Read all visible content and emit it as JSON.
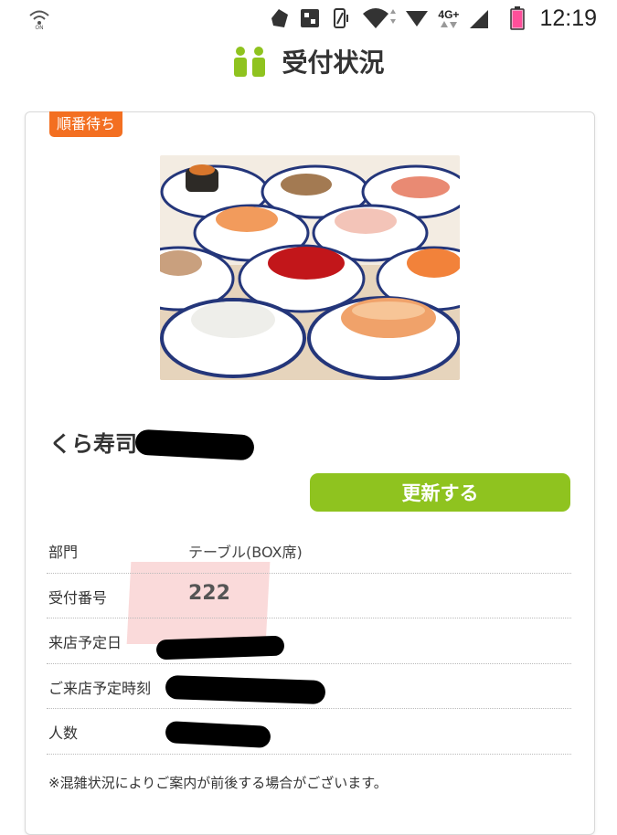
{
  "status_bar": {
    "time": "12:19",
    "network_label": "4G+",
    "icons": [
      "vowifi-icon",
      "notification-icon",
      "nfc-icon",
      "vibrate-icon",
      "wifi-icon",
      "signal-icon",
      "battery-icon"
    ]
  },
  "header": {
    "title": "受付状況",
    "icon": "people-icon",
    "accent_color": "#8fc31f"
  },
  "card": {
    "badge": "順番待ち",
    "badge_color": "#f36f21",
    "photo_alt": "sushi-photo",
    "store_name": "くら寿司",
    "refresh_button": "更新する",
    "rows": [
      {
        "label": "部門",
        "value": "テーブル(BOX席)"
      },
      {
        "label": "受付番号",
        "value": "222"
      },
      {
        "label": "来店予定日",
        "value": ""
      },
      {
        "label": "ご来店予定時刻",
        "value": ""
      },
      {
        "label": "人数",
        "value": ""
      }
    ],
    "note": "※混雑状況によりご案内が前後する場合がございます。"
  }
}
